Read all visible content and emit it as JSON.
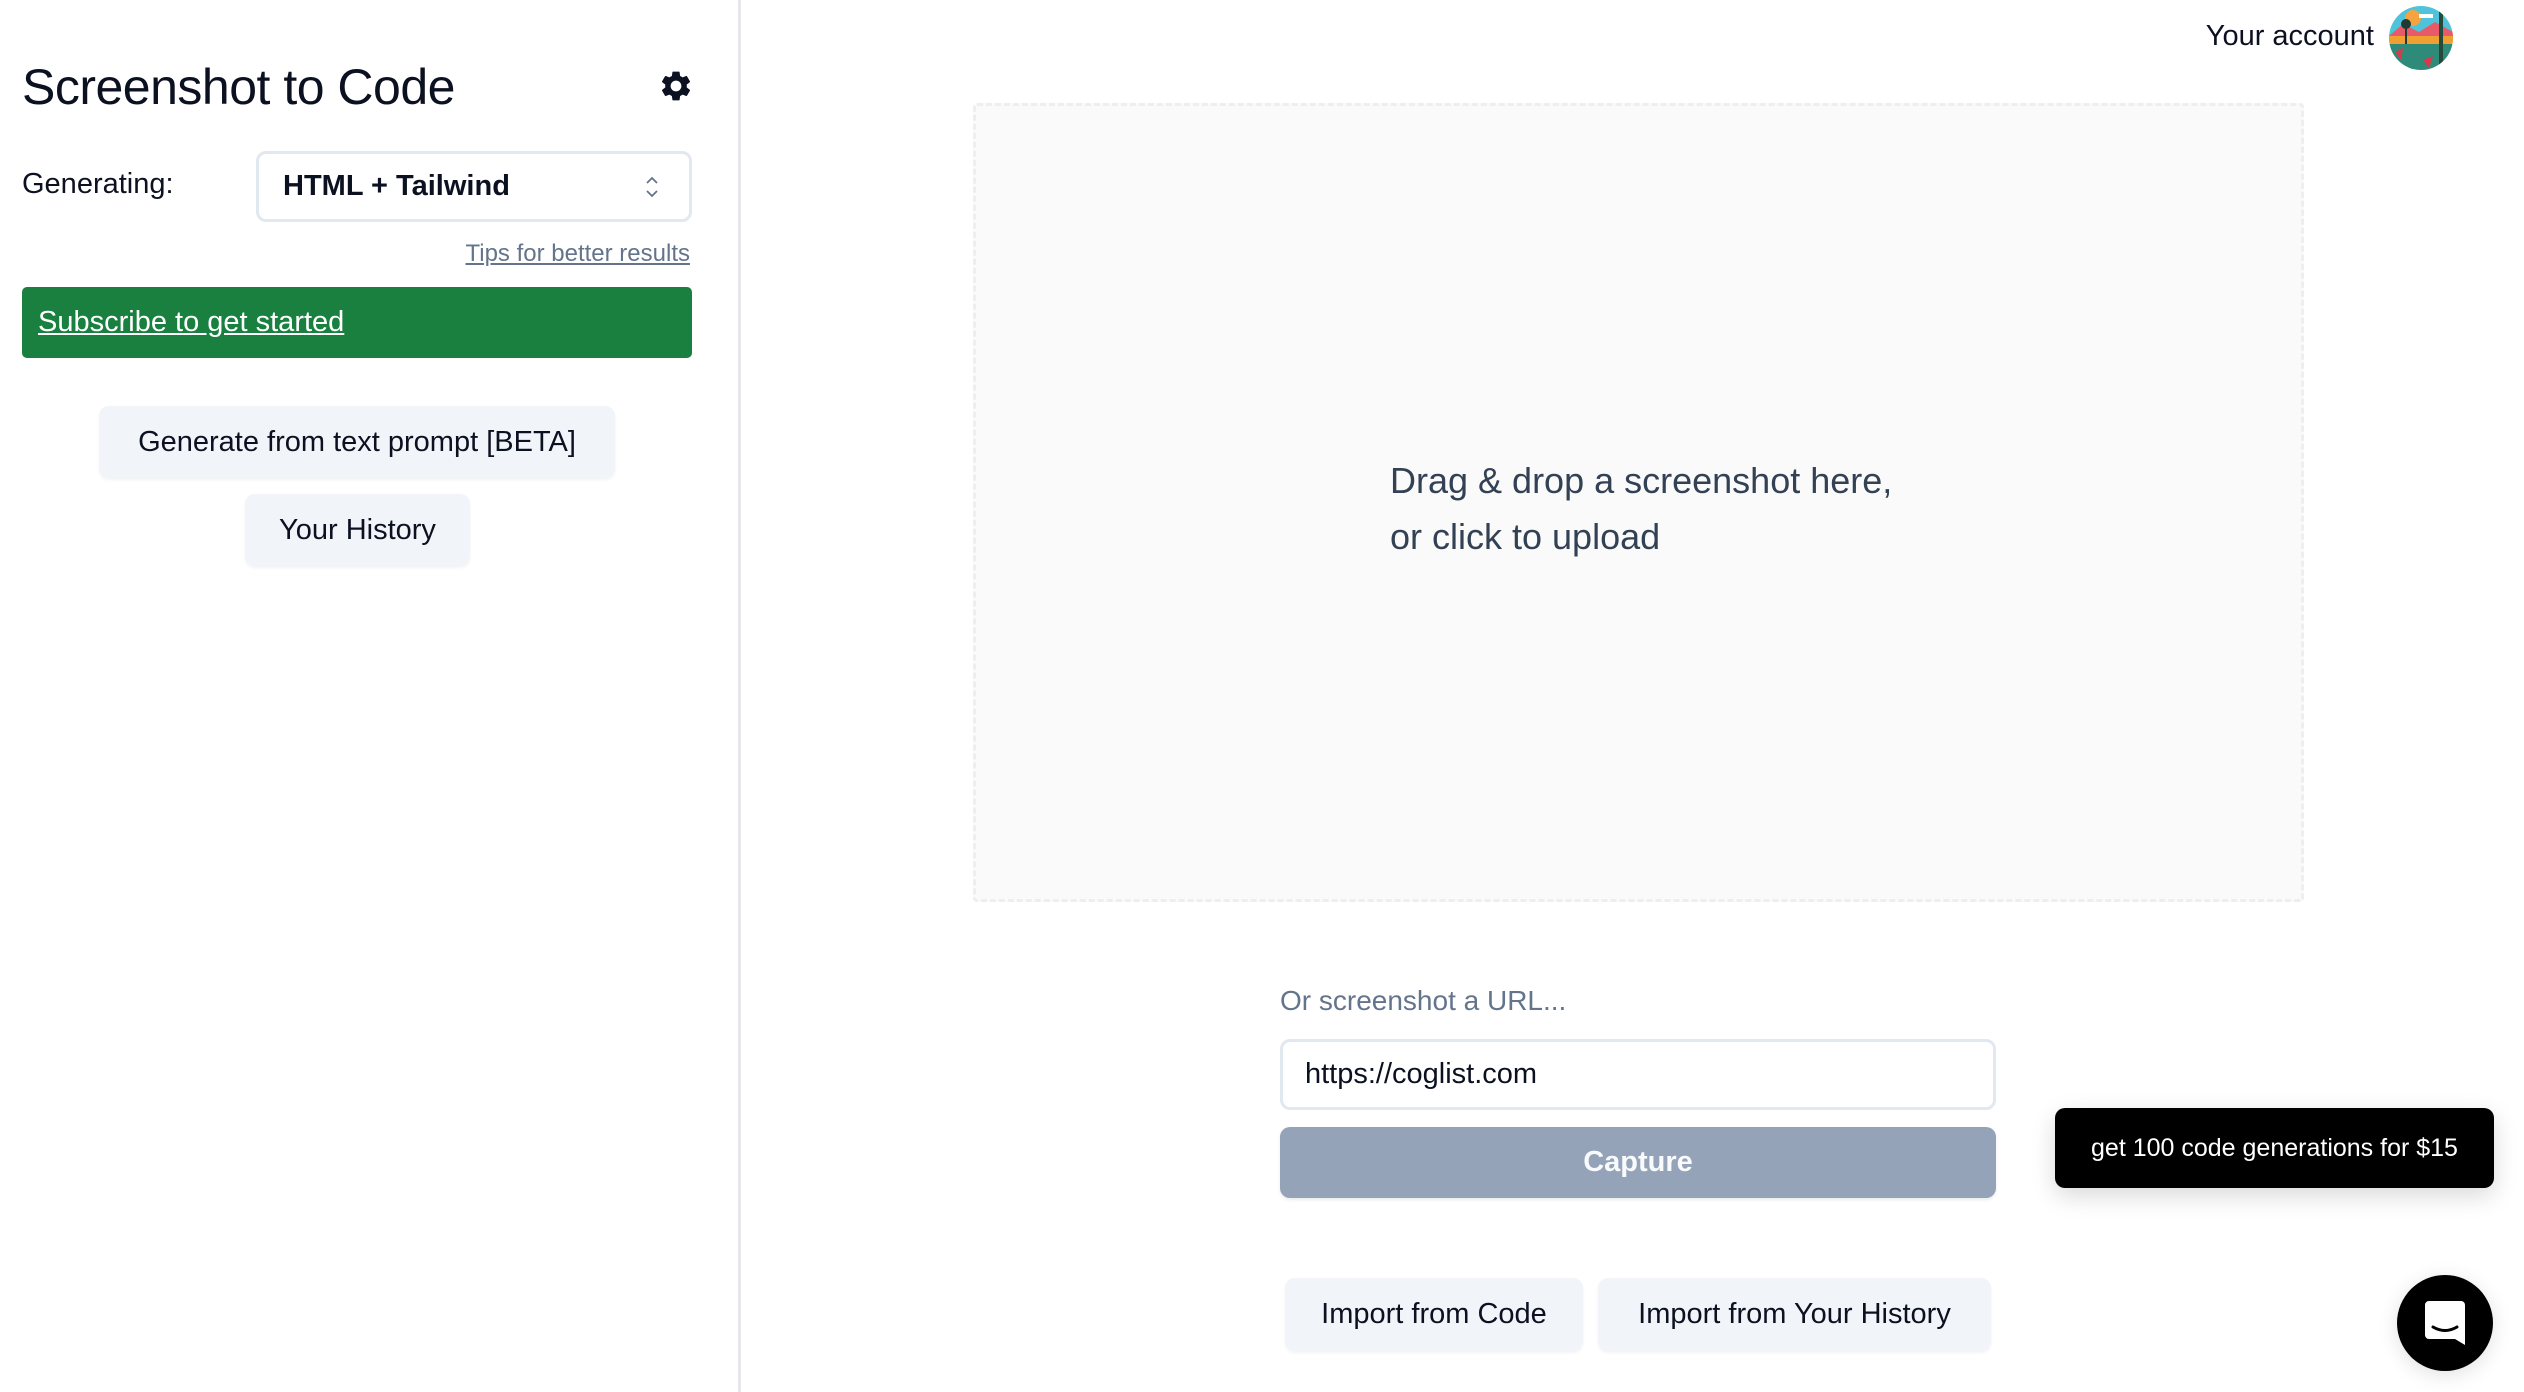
{
  "sidebar": {
    "title": "Screenshot to Code",
    "settings_icon": "gear-icon",
    "generating_label": "Generating:",
    "stack_select": {
      "value": "HTML + Tailwind"
    },
    "tips_link": "Tips for better results",
    "subscribe_label": "Subscribe to get started",
    "text_prompt_button": "Generate from text prompt [BETA]",
    "history_button": "Your History"
  },
  "header": {
    "account_label": "Your account",
    "avatar_icon": "user-avatar"
  },
  "main": {
    "dropzone": {
      "line1": "Drag & drop a screenshot here,",
      "line2": "or click to upload"
    },
    "url_section": {
      "label": "Or screenshot a URL...",
      "input_value": "https://coglist.com",
      "capture_button": "Capture"
    },
    "import_code_button": "Import from Code",
    "import_history_button": "Import from Your History"
  },
  "promo": {
    "text": "get 100 code generations for $15"
  },
  "chat_widget": {
    "icon": "chat-bubble-icon"
  },
  "colors": {
    "subscribe_bg": "#198040",
    "capture_bg": "#94a3b8",
    "soft_button_bg": "#f1f5f9",
    "promo_bg": "#000000",
    "dropzone_bg": "#fafafa"
  }
}
